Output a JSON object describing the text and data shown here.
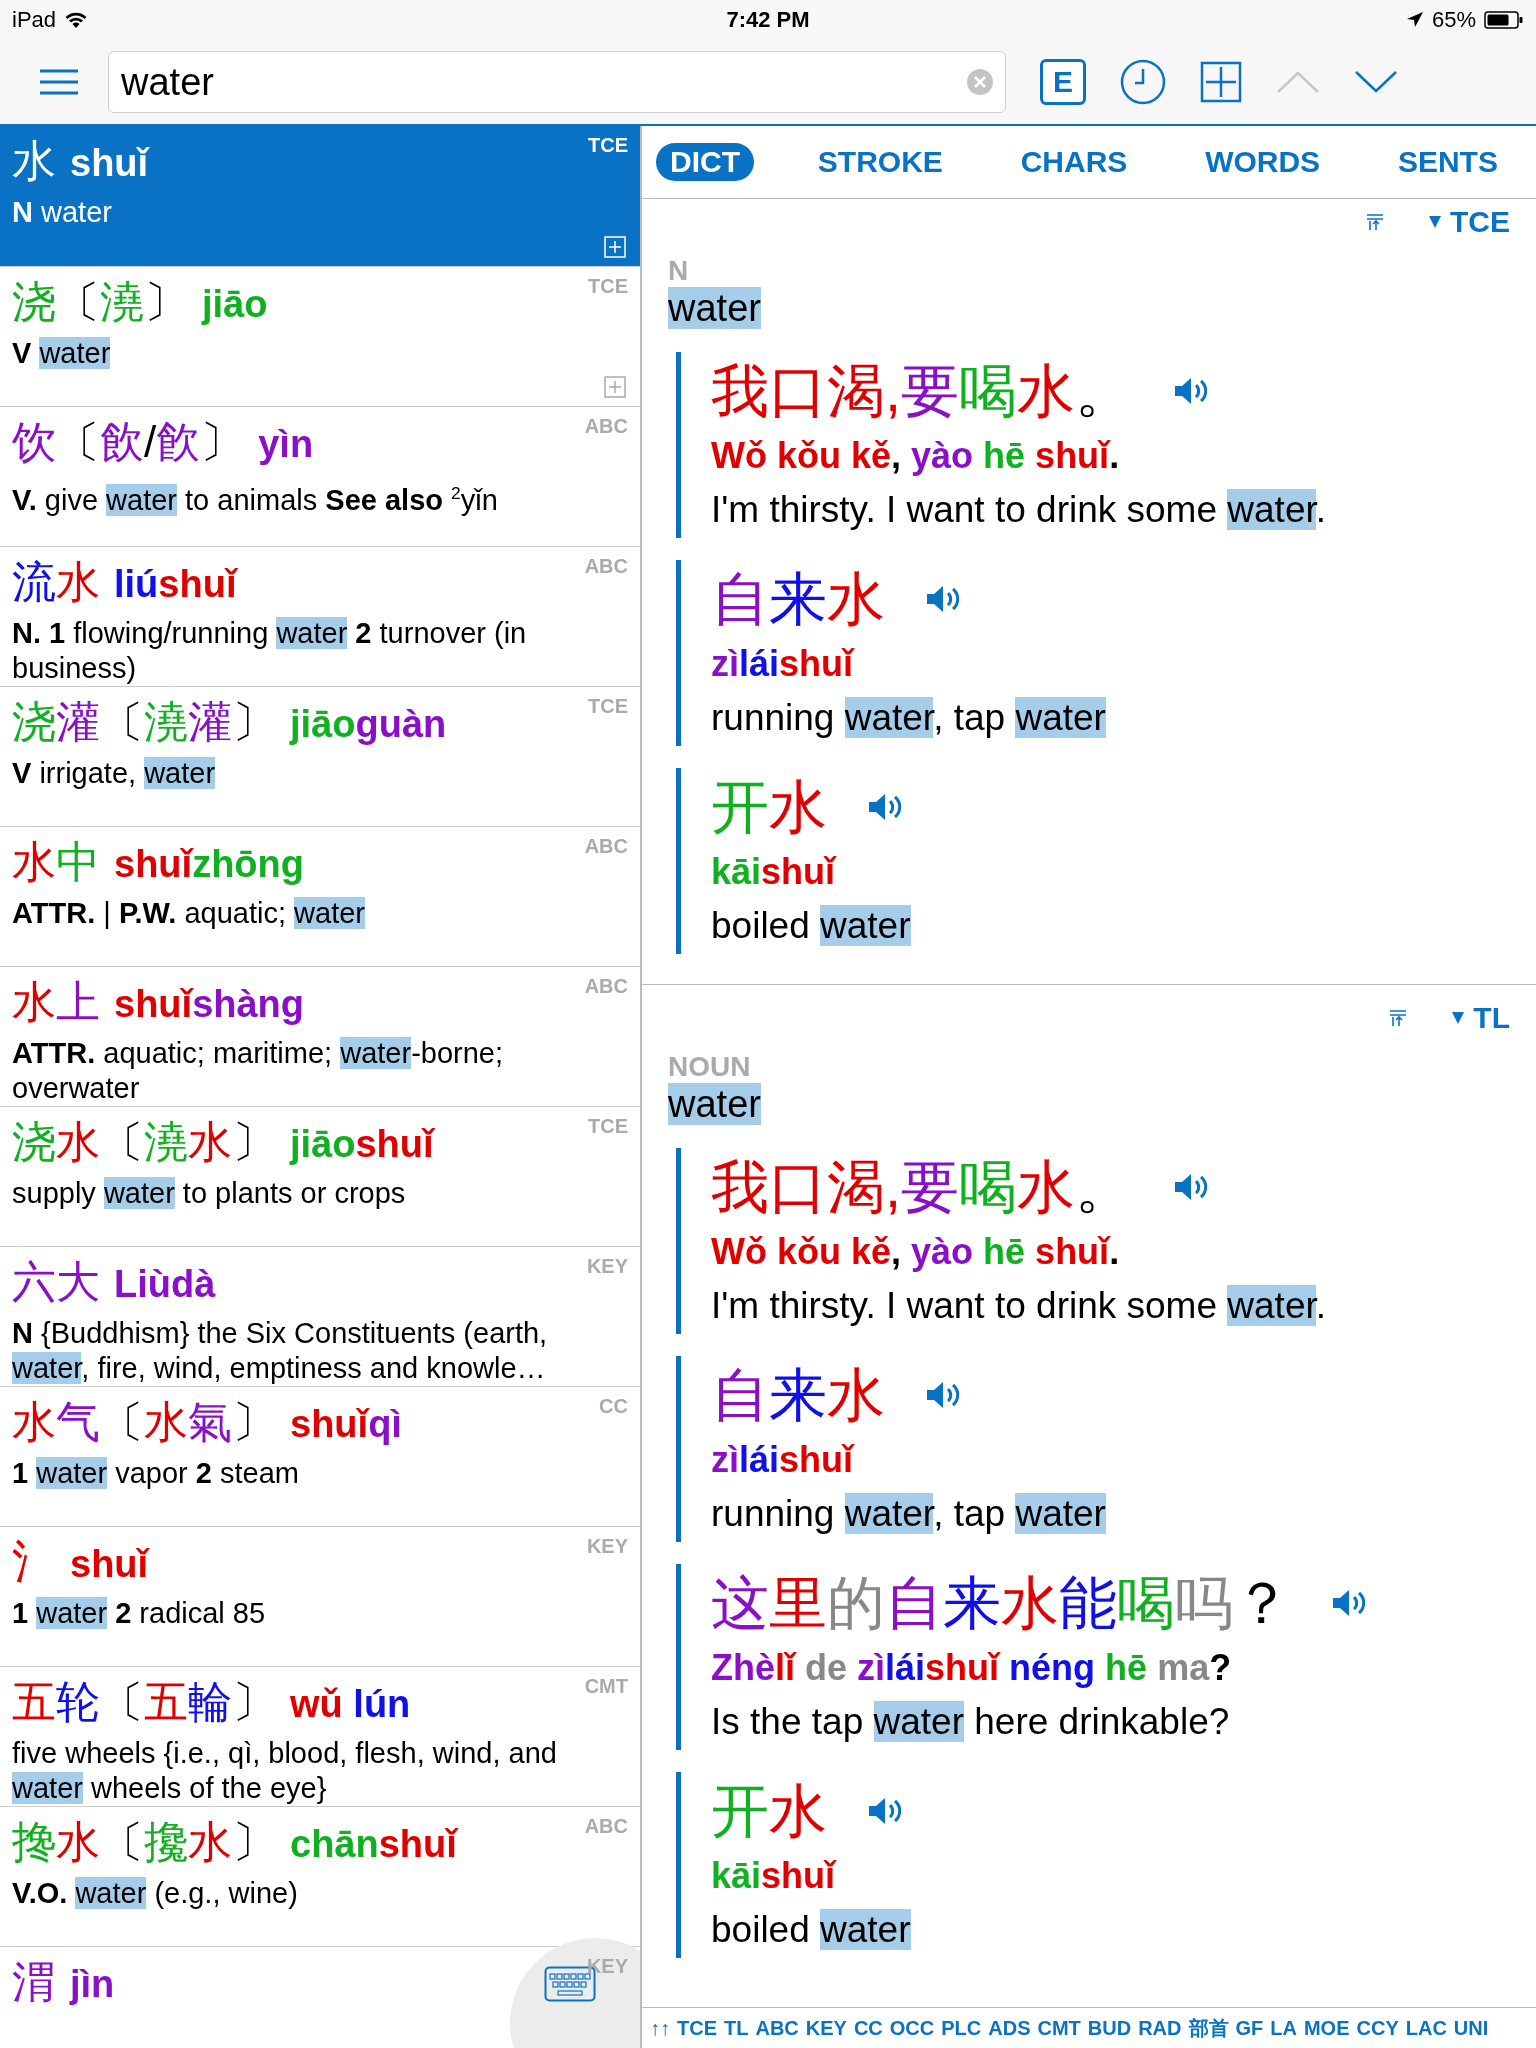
{
  "status_bar": {
    "device": "iPad",
    "time": "7:42 PM",
    "battery": "65%"
  },
  "toolbar": {
    "search": {
      "value": "water"
    },
    "mode_button": "E",
    "nav": [
      {
        "kind": "up",
        "disabled": true
      },
      {
        "kind": "down",
        "disabled": false
      }
    ]
  },
  "results": [
    {
      "selected": true,
      "source": "TCE",
      "expandable": true,
      "hanzi": [
        {
          "text": "水"
        }
      ],
      "pinyin": [
        {
          "text": "shuǐ"
        }
      ],
      "definition": [
        {
          "text": "N",
          "kind": "bold"
        },
        {
          "text": "  water",
          "kind": "plain"
        }
      ]
    },
    {
      "selected": false,
      "source": "TCE",
      "expandable": true,
      "hanzi": [
        {
          "text": "浇",
          "color": "#10b020"
        },
        {
          "text": "〔",
          "color": "#000000"
        },
        {
          "text": "澆",
          "color": "#10b020"
        },
        {
          "text": "〕",
          "color": "#000000"
        }
      ],
      "pinyin": [
        {
          "text": "jiāo",
          "color": "#10b020"
        }
      ],
      "definition": [
        {
          "text": "V  ",
          "kind": "bold"
        },
        {
          "text": "water",
          "kind": "hit"
        }
      ]
    },
    {
      "selected": false,
      "source": "ABC",
      "expandable": false,
      "hanzi": [
        {
          "text": "饮",
          "color": "#8a10c8"
        },
        {
          "text": "〔",
          "color": "#000000"
        },
        {
          "text": "飲",
          "color": "#8a10c8"
        },
        {
          "text": "/",
          "color": "#000000"
        },
        {
          "text": "飮",
          "color": "#8a10c8"
        },
        {
          "text": "〕",
          "color": "#000000"
        }
      ],
      "pinyin": [
        {
          "text": "yìn",
          "color": "#8a10c8"
        }
      ],
      "definition": [
        {
          "text": "V.",
          "kind": "bold"
        },
        {
          "text": " give ",
          "kind": "plain"
        },
        {
          "text": "water",
          "kind": "hit"
        },
        {
          "text": " to animals ",
          "kind": "plain"
        },
        {
          "text": "See also ",
          "kind": "bold"
        },
        {
          "text": "2",
          "kind": "sup"
        },
        {
          "text": "yǐn",
          "kind": "plain"
        }
      ]
    },
    {
      "selected": false,
      "source": "ABC",
      "expandable": false,
      "hanzi": [
        {
          "text": "流",
          "color": "#1010e8"
        },
        {
          "text": "水",
          "color": "#e00000"
        }
      ],
      "pinyin": [
        {
          "text": "liú",
          "color": "#1010e8"
        },
        {
          "text": "shuǐ",
          "color": "#e00000"
        }
      ],
      "definition": [
        {
          "text": "N.  1",
          "kind": "bold"
        },
        {
          "text": " flowing/running ",
          "kind": "plain"
        },
        {
          "text": "water",
          "kind": "hit"
        },
        {
          "text": "  2",
          "kind": "bold"
        },
        {
          "text": " turnover (in business)",
          "kind": "plain"
        }
      ]
    },
    {
      "selected": false,
      "source": "TCE",
      "expandable": false,
      "hanzi": [
        {
          "text": "浇",
          "color": "#10b020"
        },
        {
          "text": "灌",
          "color": "#8a10c8"
        },
        {
          "text": "〔",
          "color": "#000000"
        },
        {
          "text": "澆",
          "color": "#10b020"
        },
        {
          "text": "灌",
          "color": "#8a10c8"
        },
        {
          "text": "〕",
          "color": "#000000"
        }
      ],
      "pinyin": [
        {
          "text": "jiāo",
          "color": "#10b020"
        },
        {
          "text": "guàn",
          "color": "#8a10c8"
        }
      ],
      "definition": [
        {
          "text": "V",
          "kind": "bold"
        },
        {
          "text": "  irrigate, ",
          "kind": "plain"
        },
        {
          "text": "water",
          "kind": "hit"
        }
      ]
    },
    {
      "selected": false,
      "source": "ABC",
      "expandable": false,
      "hanzi": [
        {
          "text": "水",
          "color": "#e00000"
        },
        {
          "text": "中",
          "color": "#10b020"
        }
      ],
      "pinyin": [
        {
          "text": "shuǐ",
          "color": "#e00000"
        },
        {
          "text": "zhōng",
          "color": "#10b020"
        }
      ],
      "definition": [
        {
          "text": "ATTR.",
          "kind": "bold"
        },
        {
          "text": " | ",
          "kind": "plain"
        },
        {
          "text": "P.W.",
          "kind": "bold"
        },
        {
          "text": " aquatic; ",
          "kind": "plain"
        },
        {
          "text": "water",
          "kind": "hit"
        }
      ]
    },
    {
      "selected": false,
      "source": "ABC",
      "expandable": false,
      "hanzi": [
        {
          "text": "水",
          "color": "#e00000"
        },
        {
          "text": "上",
          "color": "#8a10c8"
        }
      ],
      "pinyin": [
        {
          "text": "shuǐ",
          "color": "#e00000"
        },
        {
          "text": "shàng",
          "color": "#8a10c8"
        }
      ],
      "definition": [
        {
          "text": "ATTR.",
          "kind": "bold"
        },
        {
          "text": " aquatic; maritime; ",
          "kind": "plain"
        },
        {
          "text": "water",
          "kind": "hit"
        },
        {
          "text": "-borne; overwater",
          "kind": "plain"
        }
      ]
    },
    {
      "selected": false,
      "source": "TCE",
      "expandable": false,
      "hanzi": [
        {
          "text": "浇",
          "color": "#10b020"
        },
        {
          "text": "水",
          "color": "#e00000"
        },
        {
          "text": "〔",
          "color": "#000000"
        },
        {
          "text": "澆",
          "color": "#10b020"
        },
        {
          "text": "水",
          "color": "#e00000"
        },
        {
          "text": "〕",
          "color": "#000000"
        }
      ],
      "pinyin": [
        {
          "text": "jiāo",
          "color": "#10b020"
        },
        {
          "text": "shuǐ",
          "color": "#e00000"
        }
      ],
      "definition": [
        {
          "text": "supply ",
          "kind": "plain"
        },
        {
          "text": "water",
          "kind": "hit"
        },
        {
          "text": " to plants or crops",
          "kind": "plain"
        }
      ]
    },
    {
      "selected": false,
      "source": "KEY",
      "expandable": false,
      "hanzi": [
        {
          "text": "六",
          "color": "#8a10c8"
        },
        {
          "text": "大",
          "color": "#8a10c8"
        }
      ],
      "pinyin": [
        {
          "text": "Liù",
          "color": "#8a10c8"
        },
        {
          "text": "dà",
          "color": "#8a10c8"
        }
      ],
      "definition": [
        {
          "text": "N",
          "kind": "bold"
        },
        {
          "text": " {Buddhism} the Six Constituents (earth, ",
          "kind": "plain"
        },
        {
          "text": "water",
          "kind": "hit"
        },
        {
          "text": ", fire, wind, emptiness and knowle…",
          "kind": "plain"
        }
      ]
    },
    {
      "selected": false,
      "source": "CC",
      "expandable": false,
      "hanzi": [
        {
          "text": "水",
          "color": "#e00000"
        },
        {
          "text": "气",
          "color": "#8a10c8"
        },
        {
          "text": "〔",
          "color": "#000000"
        },
        {
          "text": "水",
          "color": "#e00000"
        },
        {
          "text": "氣",
          "color": "#8a10c8"
        },
        {
          "text": "〕",
          "color": "#000000"
        }
      ],
      "pinyin": [
        {
          "text": "shuǐ",
          "color": "#e00000"
        },
        {
          "text": "qì",
          "color": "#8a10c8"
        }
      ],
      "definition": [
        {
          "text": "1 ",
          "kind": "bold"
        },
        {
          "text": "water",
          "kind": "hit"
        },
        {
          "text": " vapor  ",
          "kind": "plain"
        },
        {
          "text": "2",
          "kind": "bold"
        },
        {
          "text": " steam",
          "kind": "plain"
        }
      ]
    },
    {
      "selected": false,
      "source": "KEY",
      "expandable": false,
      "hanzi": [
        {
          "text": "氵",
          "color": "#e00000"
        }
      ],
      "pinyin": [
        {
          "text": "shuǐ",
          "color": "#e00000"
        }
      ],
      "definition": [
        {
          "text": "1 ",
          "kind": "bold"
        },
        {
          "text": "water",
          "kind": "hit"
        },
        {
          "text": "  2",
          "kind": "bold"
        },
        {
          "text": " radical 85",
          "kind": "plain"
        }
      ]
    },
    {
      "selected": false,
      "source": "CMT",
      "expandable": false,
      "hanzi": [
        {
          "text": "五",
          "color": "#e00000"
        },
        {
          "text": "轮",
          "color": "#1010e8"
        },
        {
          "text": "〔",
          "color": "#000000"
        },
        {
          "text": "五",
          "color": "#e00000"
        },
        {
          "text": "輪",
          "color": "#1010e8"
        },
        {
          "text": "〕",
          "color": "#000000"
        }
      ],
      "pinyin": [
        {
          "text": "wǔ ",
          "color": "#e00000"
        },
        {
          "text": "lún",
          "color": "#1010e8"
        }
      ],
      "definition": [
        {
          "text": "five wheels {i.e., qì, blood, flesh, wind, and ",
          "kind": "plain"
        },
        {
          "text": "water",
          "kind": "hit"
        },
        {
          "text": " wheels of the eye}",
          "kind": "plain"
        }
      ]
    },
    {
      "selected": false,
      "source": "ABC",
      "expandable": false,
      "hanzi": [
        {
          "text": "搀",
          "color": "#10b020"
        },
        {
          "text": "水",
          "color": "#e00000"
        },
        {
          "text": "〔",
          "color": "#000000"
        },
        {
          "text": "攙",
          "color": "#10b020"
        },
        {
          "text": "水",
          "color": "#e00000"
        },
        {
          "text": "〕",
          "color": "#000000"
        }
      ],
      "pinyin": [
        {
          "text": "chān",
          "color": "#10b020"
        },
        {
          "text": "shuǐ",
          "color": "#e00000"
        }
      ],
      "definition": [
        {
          "text": "V.O. ",
          "kind": "bold"
        },
        {
          "text": "water",
          "kind": "hit"
        },
        {
          "text": " (e.g., wine)",
          "kind": "plain"
        }
      ]
    },
    {
      "selected": false,
      "source": "KEY",
      "expandable": false,
      "hanzi": [
        {
          "text": "渭",
          "color": "#8a10c8"
        }
      ],
      "pinyin": [
        {
          "text": "jìn",
          "color": "#8a10c8"
        }
      ]
    }
  ],
  "tabs": [
    {
      "label": "DICT",
      "selected": true
    },
    {
      "label": "STROKE",
      "selected": false
    },
    {
      "label": "CHARS",
      "selected": false
    },
    {
      "label": "WORDS",
      "selected": false
    },
    {
      "label": "SENTS",
      "selected": false
    }
  ],
  "sections": [
    {
      "source": "TCE",
      "pos": "N",
      "gloss": "water",
      "examples": [
        {
          "hanzi": [
            {
              "text": "我口渴,",
              "color": "#e00000"
            },
            {
              "text": "要",
              "color": "#8a10c8"
            },
            {
              "text": "喝",
              "color": "#10b020"
            },
            {
              "text": "水",
              "color": "#e00000"
            },
            {
              "text": "。",
              "color": "#000000"
            }
          ],
          "pinyin": [
            {
              "text": "Wǒ kǒu kě",
              "color": "#e00000"
            },
            {
              "text": ", ",
              "color": "#000000"
            },
            {
              "text": "yào ",
              "color": "#8a10c8"
            },
            {
              "text": "hē ",
              "color": "#10b020"
            },
            {
              "text": "shuǐ",
              "color": "#e00000"
            },
            {
              "text": ".",
              "color": "#000000"
            }
          ],
          "translation": [
            {
              "text": "I'm thirsty. I want to drink some ",
              "kind": "plain"
            },
            {
              "text": "water",
              "kind": "hit"
            },
            {
              "text": ".",
              "kind": "plain"
            }
          ]
        },
        {
          "hanzi": [
            {
              "text": "自",
              "color": "#8a10c8"
            },
            {
              "text": "来",
              "color": "#1010e8"
            },
            {
              "text": "水",
              "color": "#e00000"
            }
          ],
          "pinyin": [
            {
              "text": "zì",
              "color": "#8a10c8"
            },
            {
              "text": "lái",
              "color": "#1010e8"
            },
            {
              "text": "shuǐ",
              "color": "#e00000"
            }
          ],
          "translation": [
            {
              "text": "running ",
              "kind": "plain"
            },
            {
              "text": "water",
              "kind": "hit"
            },
            {
              "text": ", tap ",
              "kind": "plain"
            },
            {
              "text": "water",
              "kind": "hit"
            }
          ]
        },
        {
          "hanzi": [
            {
              "text": "开",
              "color": "#10b020"
            },
            {
              "text": "水",
              "color": "#e00000"
            }
          ],
          "pinyin": [
            {
              "text": "kāi",
              "color": "#10b020"
            },
            {
              "text": "shuǐ",
              "color": "#e00000"
            }
          ],
          "translation": [
            {
              "text": "boiled ",
              "kind": "plain"
            },
            {
              "text": "water",
              "kind": "hit"
            }
          ]
        }
      ]
    },
    {
      "source": "TL",
      "pos": "NOUN",
      "gloss": "water",
      "examples": [
        {
          "hanzi": [
            {
              "text": "我口渴,",
              "color": "#e00000"
            },
            {
              "text": "要",
              "color": "#8a10c8"
            },
            {
              "text": "喝",
              "color": "#10b020"
            },
            {
              "text": "水",
              "color": "#e00000"
            },
            {
              "text": "。",
              "color": "#000000"
            }
          ],
          "pinyin": [
            {
              "text": "Wǒ kǒu kě",
              "color": "#e00000"
            },
            {
              "text": ", ",
              "color": "#000000"
            },
            {
              "text": "yào ",
              "color": "#8a10c8"
            },
            {
              "text": "hē ",
              "color": "#10b020"
            },
            {
              "text": "shuǐ",
              "color": "#e00000"
            },
            {
              "text": ".",
              "color": "#000000"
            }
          ],
          "translation": [
            {
              "text": "I'm thirsty. I want to drink some ",
              "kind": "plain"
            },
            {
              "text": "water",
              "kind": "hit"
            },
            {
              "text": ".",
              "kind": "plain"
            }
          ]
        },
        {
          "hanzi": [
            {
              "text": "自",
              "color": "#8a10c8"
            },
            {
              "text": "来",
              "color": "#1010e8"
            },
            {
              "text": "水",
              "color": "#e00000"
            }
          ],
          "pinyin": [
            {
              "text": "zì",
              "color": "#8a10c8"
            },
            {
              "text": "lái",
              "color": "#1010e8"
            },
            {
              "text": "shuǐ",
              "color": "#e00000"
            }
          ],
          "translation": [
            {
              "text": "running ",
              "kind": "plain"
            },
            {
              "text": "water",
              "kind": "hit"
            },
            {
              "text": ", tap ",
              "kind": "plain"
            },
            {
              "text": "water",
              "kind": "hit"
            }
          ]
        },
        {
          "hanzi": [
            {
              "text": "这",
              "color": "#8a10c8"
            },
            {
              "text": "里",
              "color": "#e00000"
            },
            {
              "text": "的",
              "color": "#888888"
            },
            {
              "text": "自",
              "color": "#8a10c8"
            },
            {
              "text": "来",
              "color": "#1010e8"
            },
            {
              "text": "水",
              "color": "#e00000"
            },
            {
              "text": "能",
              "color": "#1010e8"
            },
            {
              "text": "喝",
              "color": "#10b020"
            },
            {
              "text": "吗",
              "color": "#888888"
            },
            {
              "text": "？",
              "color": "#000000"
            }
          ],
          "pinyin": [
            {
              "text": "Zhè",
              "color": "#8a10c8"
            },
            {
              "text": "lǐ ",
              "color": "#e00000"
            },
            {
              "text": "de ",
              "color": "#888888"
            },
            {
              "text": "zì",
              "color": "#8a10c8"
            },
            {
              "text": "lái",
              "color": "#1010e8"
            },
            {
              "text": "shuǐ ",
              "color": "#e00000"
            },
            {
              "text": "néng ",
              "color": "#1010e8"
            },
            {
              "text": "hē ",
              "color": "#10b020"
            },
            {
              "text": "ma",
              "color": "#888888"
            },
            {
              "text": "?",
              "color": "#000000"
            }
          ],
          "translation": [
            {
              "text": "Is the tap ",
              "kind": "plain"
            },
            {
              "text": "water",
              "kind": "hit"
            },
            {
              "text": " here drinkable?",
              "kind": "plain"
            }
          ]
        },
        {
          "hanzi": [
            {
              "text": "开",
              "color": "#10b020"
            },
            {
              "text": "水",
              "color": "#e00000"
            }
          ],
          "pinyin": [
            {
              "text": "kāi",
              "color": "#10b020"
            },
            {
              "text": "shuǐ",
              "color": "#e00000"
            }
          ],
          "translation": [
            {
              "text": "boiled ",
              "kind": "plain"
            },
            {
              "text": "water",
              "kind": "hit"
            }
          ]
        }
      ]
    }
  ],
  "source_bar": {
    "jump": "↑↑",
    "sources": [
      "TCE",
      "TL",
      "ABC",
      "KEY",
      "CC",
      "OCC",
      "PLC",
      "ADS",
      "CMT",
      "BUD",
      "RAD",
      "部首",
      "GF",
      "LA",
      "MOE",
      "CCY",
      "LAC",
      "UNI"
    ]
  }
}
